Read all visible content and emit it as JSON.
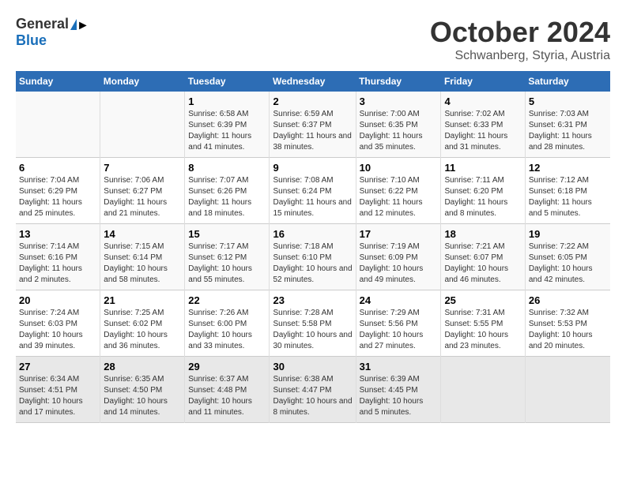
{
  "logo": {
    "general": "General",
    "blue": "Blue"
  },
  "title": {
    "month": "October 2024",
    "location": "Schwanberg, Styria, Austria"
  },
  "days_header": [
    "Sunday",
    "Monday",
    "Tuesday",
    "Wednesday",
    "Thursday",
    "Friday",
    "Saturday"
  ],
  "weeks": [
    [
      {
        "day": "",
        "info": ""
      },
      {
        "day": "",
        "info": ""
      },
      {
        "day": "1",
        "info": "Sunrise: 6:58 AM\nSunset: 6:39 PM\nDaylight: 11 hours and 41 minutes."
      },
      {
        "day": "2",
        "info": "Sunrise: 6:59 AM\nSunset: 6:37 PM\nDaylight: 11 hours and 38 minutes."
      },
      {
        "day": "3",
        "info": "Sunrise: 7:00 AM\nSunset: 6:35 PM\nDaylight: 11 hours and 35 minutes."
      },
      {
        "day": "4",
        "info": "Sunrise: 7:02 AM\nSunset: 6:33 PM\nDaylight: 11 hours and 31 minutes."
      },
      {
        "day": "5",
        "info": "Sunrise: 7:03 AM\nSunset: 6:31 PM\nDaylight: 11 hours and 28 minutes."
      }
    ],
    [
      {
        "day": "6",
        "info": "Sunrise: 7:04 AM\nSunset: 6:29 PM\nDaylight: 11 hours and 25 minutes."
      },
      {
        "day": "7",
        "info": "Sunrise: 7:06 AM\nSunset: 6:27 PM\nDaylight: 11 hours and 21 minutes."
      },
      {
        "day": "8",
        "info": "Sunrise: 7:07 AM\nSunset: 6:26 PM\nDaylight: 11 hours and 18 minutes."
      },
      {
        "day": "9",
        "info": "Sunrise: 7:08 AM\nSunset: 6:24 PM\nDaylight: 11 hours and 15 minutes."
      },
      {
        "day": "10",
        "info": "Sunrise: 7:10 AM\nSunset: 6:22 PM\nDaylight: 11 hours and 12 minutes."
      },
      {
        "day": "11",
        "info": "Sunrise: 7:11 AM\nSunset: 6:20 PM\nDaylight: 11 hours and 8 minutes."
      },
      {
        "day": "12",
        "info": "Sunrise: 7:12 AM\nSunset: 6:18 PM\nDaylight: 11 hours and 5 minutes."
      }
    ],
    [
      {
        "day": "13",
        "info": "Sunrise: 7:14 AM\nSunset: 6:16 PM\nDaylight: 11 hours and 2 minutes."
      },
      {
        "day": "14",
        "info": "Sunrise: 7:15 AM\nSunset: 6:14 PM\nDaylight: 10 hours and 58 minutes."
      },
      {
        "day": "15",
        "info": "Sunrise: 7:17 AM\nSunset: 6:12 PM\nDaylight: 10 hours and 55 minutes."
      },
      {
        "day": "16",
        "info": "Sunrise: 7:18 AM\nSunset: 6:10 PM\nDaylight: 10 hours and 52 minutes."
      },
      {
        "day": "17",
        "info": "Sunrise: 7:19 AM\nSunset: 6:09 PM\nDaylight: 10 hours and 49 minutes."
      },
      {
        "day": "18",
        "info": "Sunrise: 7:21 AM\nSunset: 6:07 PM\nDaylight: 10 hours and 46 minutes."
      },
      {
        "day": "19",
        "info": "Sunrise: 7:22 AM\nSunset: 6:05 PM\nDaylight: 10 hours and 42 minutes."
      }
    ],
    [
      {
        "day": "20",
        "info": "Sunrise: 7:24 AM\nSunset: 6:03 PM\nDaylight: 10 hours and 39 minutes."
      },
      {
        "day": "21",
        "info": "Sunrise: 7:25 AM\nSunset: 6:02 PM\nDaylight: 10 hours and 36 minutes."
      },
      {
        "day": "22",
        "info": "Sunrise: 7:26 AM\nSunset: 6:00 PM\nDaylight: 10 hours and 33 minutes."
      },
      {
        "day": "23",
        "info": "Sunrise: 7:28 AM\nSunset: 5:58 PM\nDaylight: 10 hours and 30 minutes."
      },
      {
        "day": "24",
        "info": "Sunrise: 7:29 AM\nSunset: 5:56 PM\nDaylight: 10 hours and 27 minutes."
      },
      {
        "day": "25",
        "info": "Sunrise: 7:31 AM\nSunset: 5:55 PM\nDaylight: 10 hours and 23 minutes."
      },
      {
        "day": "26",
        "info": "Sunrise: 7:32 AM\nSunset: 5:53 PM\nDaylight: 10 hours and 20 minutes."
      }
    ],
    [
      {
        "day": "27",
        "info": "Sunrise: 6:34 AM\nSunset: 4:51 PM\nDaylight: 10 hours and 17 minutes."
      },
      {
        "day": "28",
        "info": "Sunrise: 6:35 AM\nSunset: 4:50 PM\nDaylight: 10 hours and 14 minutes."
      },
      {
        "day": "29",
        "info": "Sunrise: 6:37 AM\nSunset: 4:48 PM\nDaylight: 10 hours and 11 minutes."
      },
      {
        "day": "30",
        "info": "Sunrise: 6:38 AM\nSunset: 4:47 PM\nDaylight: 10 hours and 8 minutes."
      },
      {
        "day": "31",
        "info": "Sunrise: 6:39 AM\nSunset: 4:45 PM\nDaylight: 10 hours and 5 minutes."
      },
      {
        "day": "",
        "info": ""
      },
      {
        "day": "",
        "info": ""
      }
    ]
  ],
  "week_styles": [
    "odd",
    "even",
    "odd",
    "even",
    "last"
  ]
}
